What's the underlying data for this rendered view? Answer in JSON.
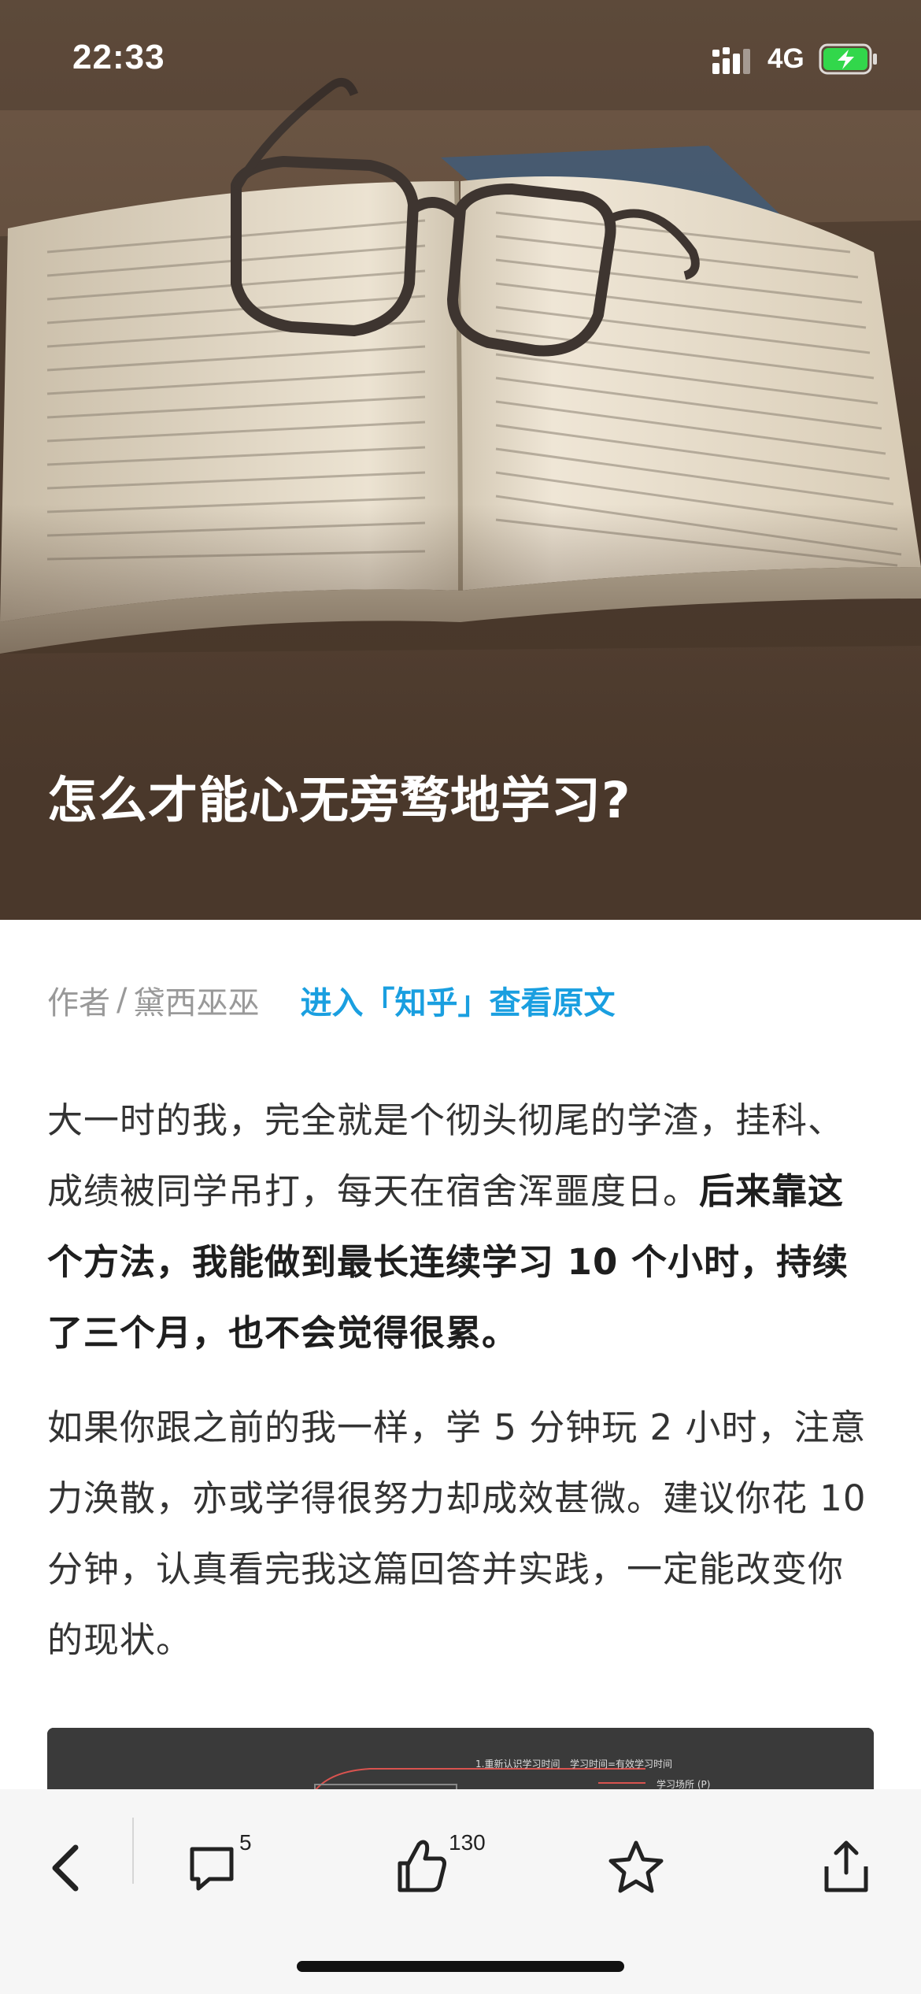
{
  "status_bar": {
    "time": "22:33",
    "network": "4G",
    "signal_icon": "signal-bars-icon",
    "battery_icon": "battery-charging-icon",
    "battery_color": "#32d74b"
  },
  "hero": {
    "title": "怎么才能心无旁骛地学习?",
    "image_icon": "book-with-glasses-image"
  },
  "byline": {
    "author_label": "作者",
    "separator": "/",
    "author_name": "黛西巫巫",
    "source_link": "进入「知乎」查看原文",
    "link_color": "#1a9fe0"
  },
  "article": {
    "paragraph1": {
      "normal": "大一时的我，完全就是个彻头彻尾的学渣，挂科、成绩被同学吊打，每天在宿舍浑噩度日。",
      "bold": "后来靠这个方法，我能做到最长连续学习 10 个小时，持续了三个月，也不会觉得很累。"
    },
    "paragraph2": "如果你跟之前的我一样，学 5 分钟玩 2 小时，注意力涣散，亦或学得很努力却成效甚微。建议你花 10 分钟，认真看完我这篇回答并实践，一定能改变你的现状。",
    "image_preview": {
      "label1": "1.重新认识学习时间",
      "label2": "学习时间=有效学习时间",
      "label3": "学习场所 (P)"
    }
  },
  "toolbar": {
    "back_icon": "chevron-left-icon",
    "comment_icon": "comment-icon",
    "comment_count": "5",
    "like_icon": "thumbs-up-icon",
    "like_count": "130",
    "favorite_icon": "star-icon",
    "share_icon": "share-icon"
  }
}
